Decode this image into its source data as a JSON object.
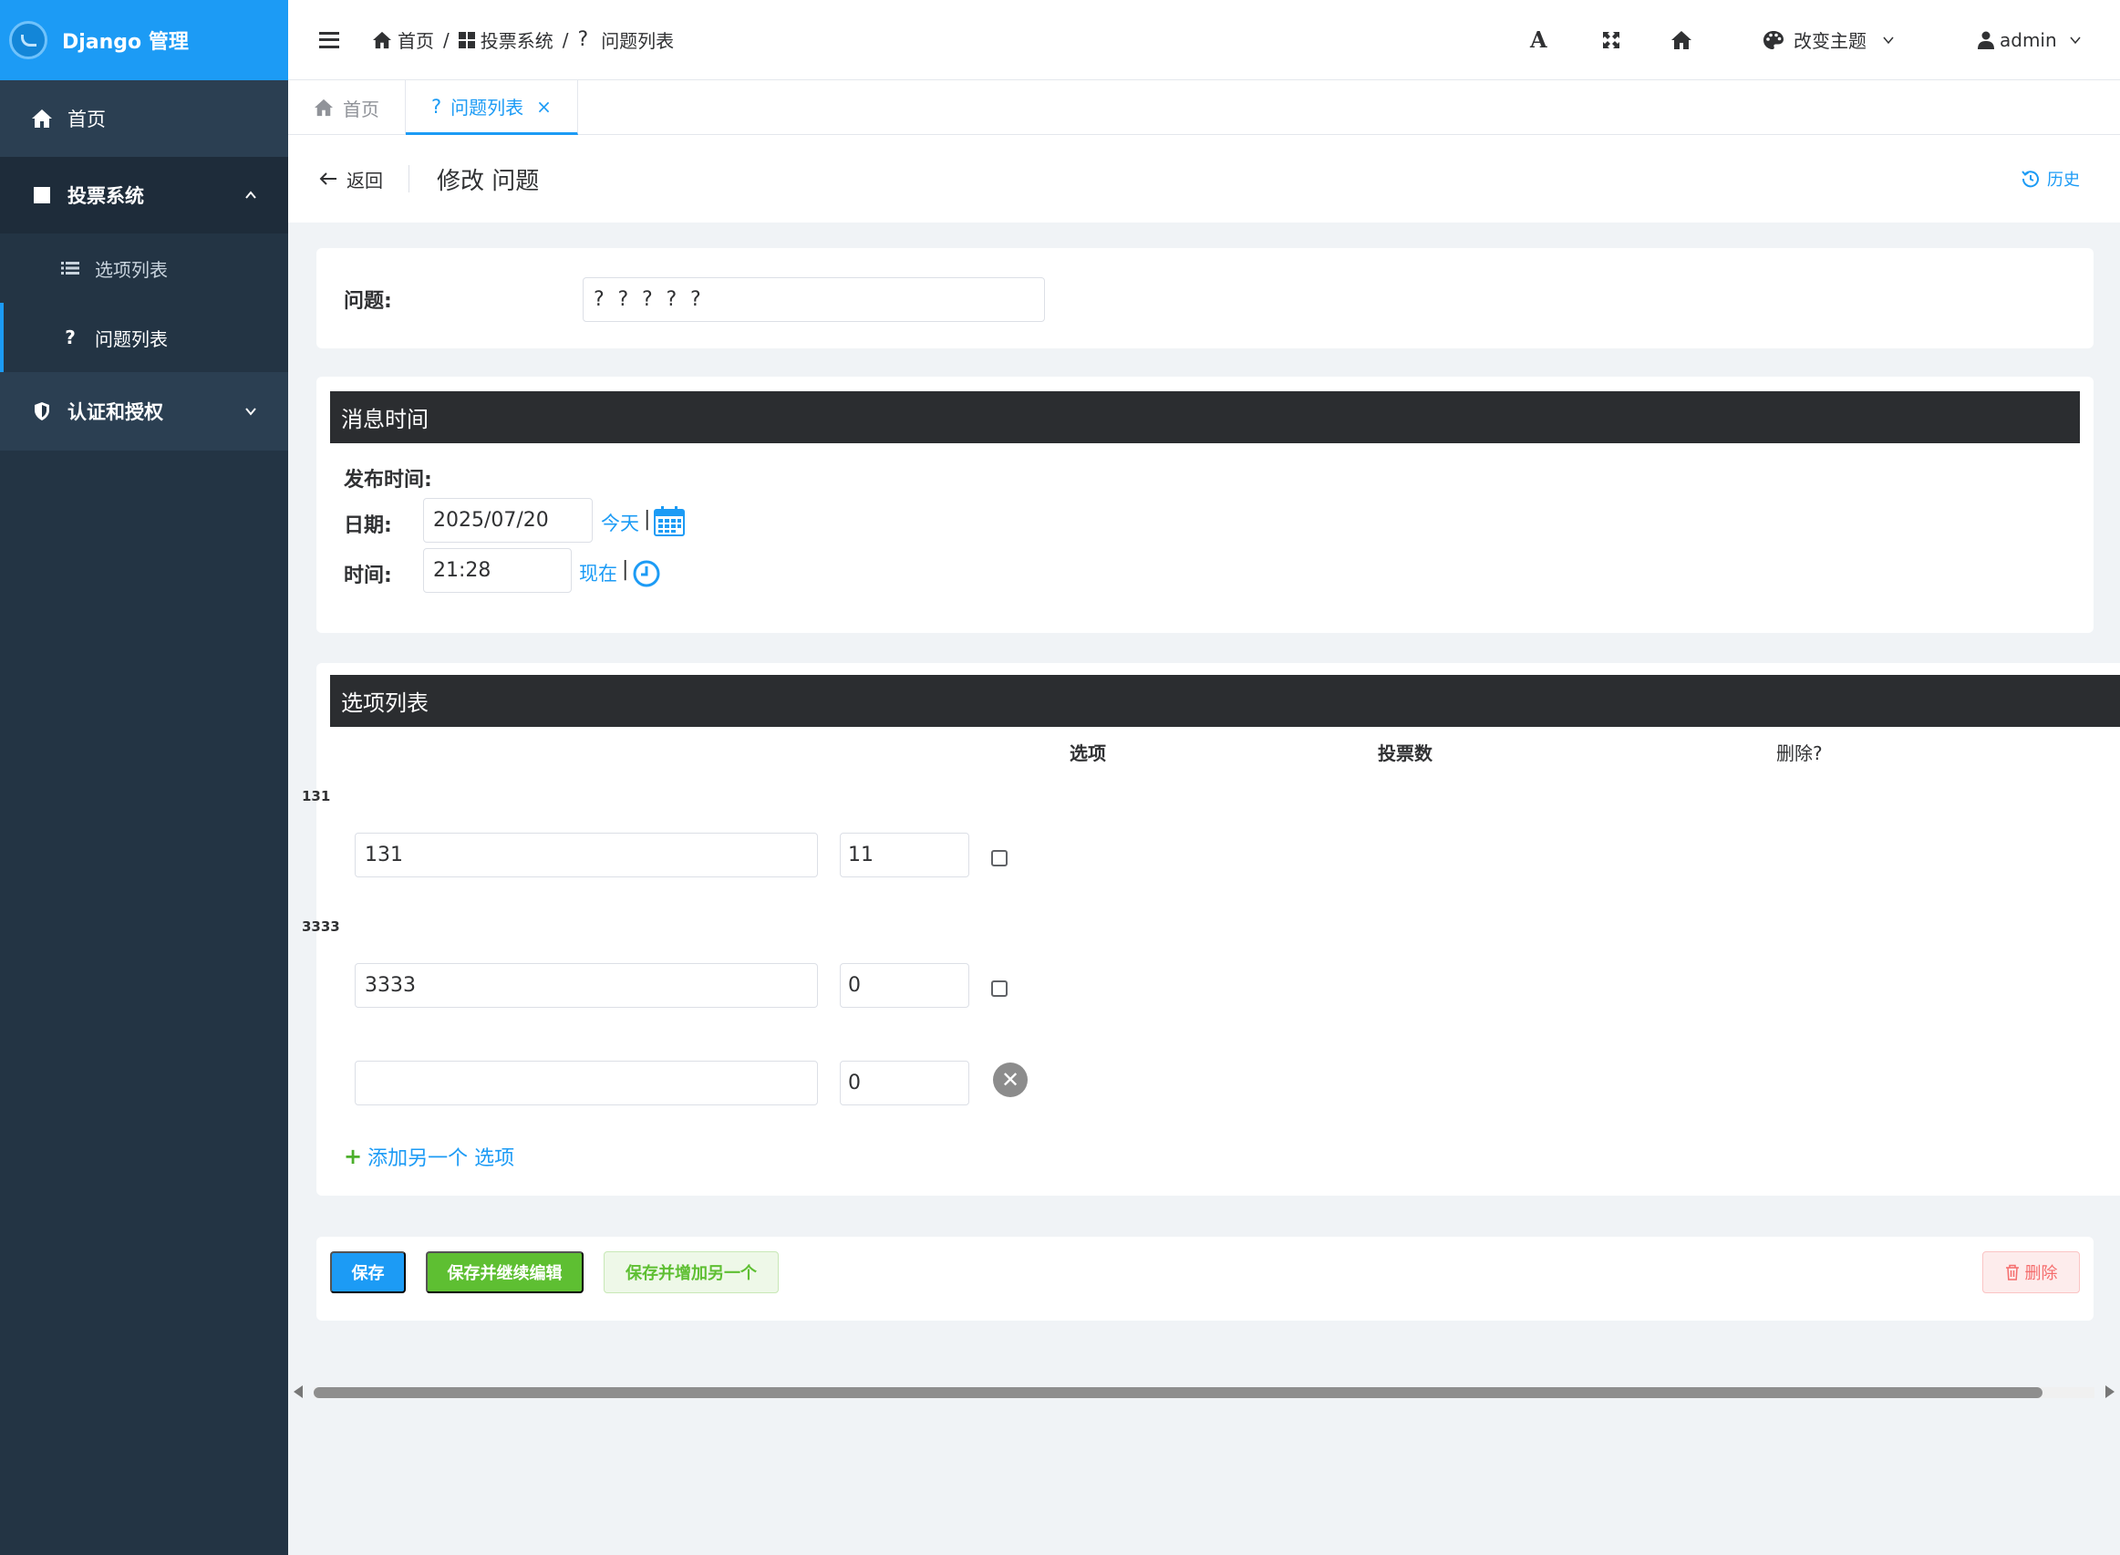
{
  "sidebar": {
    "brand": "Django 管理",
    "home": "首页",
    "group": "投票系统",
    "items": [
      {
        "label": "选项列表",
        "icon": "list-icon"
      },
      {
        "label": "问题列表",
        "icon": "question-icon"
      }
    ],
    "auth": "认证和授权"
  },
  "header": {
    "breadcrumb": [
      "首页",
      "投票系统",
      "问题列表"
    ],
    "theme": "改变主题",
    "user": "admin"
  },
  "tabs": [
    {
      "label": "首页"
    },
    {
      "label": "问题列表",
      "active": true
    }
  ],
  "page": {
    "back": "返回",
    "title": "修改 问题",
    "history": "历史"
  },
  "question": {
    "label": "问题:",
    "value": "? ? ? ? ?"
  },
  "time_section": {
    "title": "消息时间",
    "pub_label": "发布时间:",
    "date_label": "日期:",
    "date_value": "2025/07/20",
    "today_link": "今天",
    "time_label": "时间:",
    "time_value": "21:28",
    "now_link": "现在",
    "separator": "|"
  },
  "choices": {
    "title": "选项列表",
    "columns": [
      "选项",
      "投票数",
      "删除?"
    ],
    "rows": [
      {
        "caption": "131",
        "text": "131",
        "votes": "11"
      },
      {
        "caption": "3333",
        "text": "3333",
        "votes": "0"
      },
      {
        "caption": "",
        "text": "",
        "votes": "0"
      }
    ],
    "add_link": "添加另一个 选项"
  },
  "actions": {
    "save": "保存",
    "save_continue": "保存并继续编辑",
    "save_add": "保存并增加另一个",
    "delete": "删除"
  },
  "colors": {
    "primary": "#1c9bf5",
    "sidebar": "#233444",
    "success": "#5ebf32",
    "danger": "#f56c6c"
  }
}
